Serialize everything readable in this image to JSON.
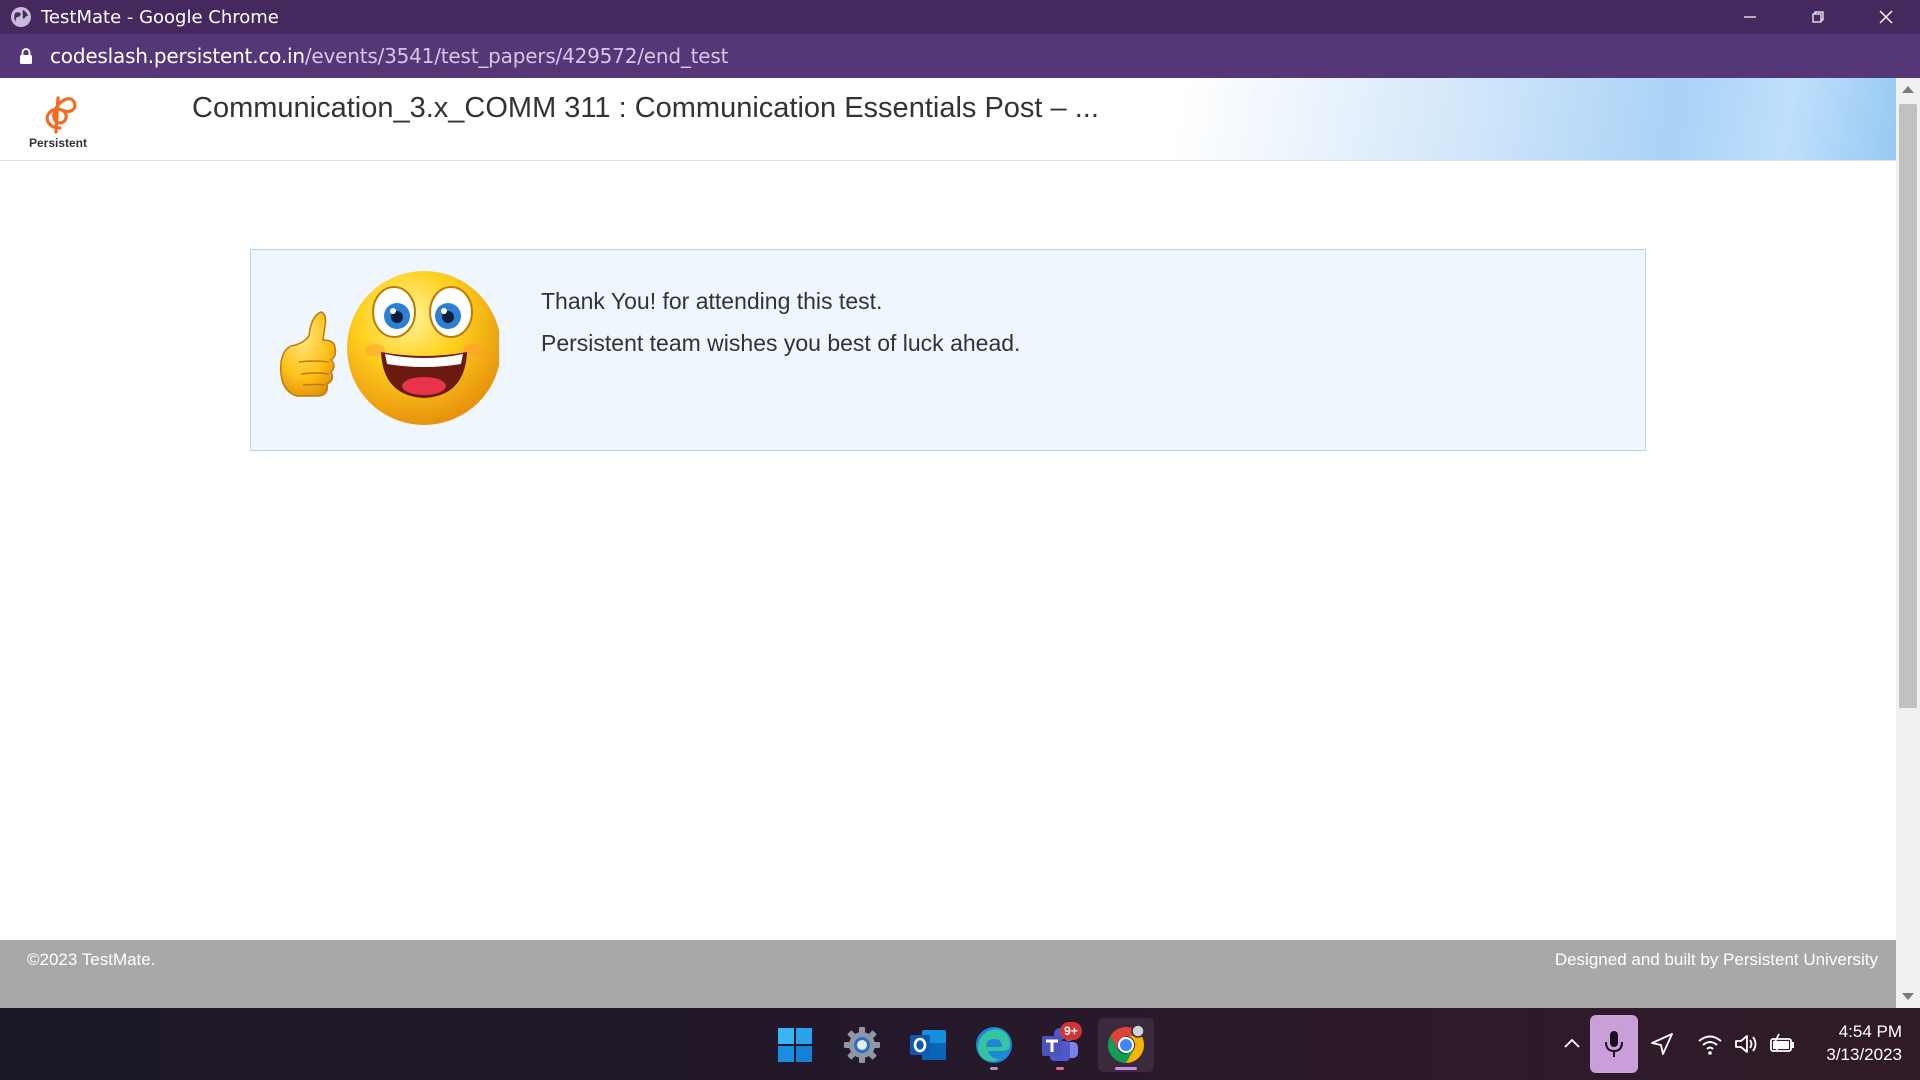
{
  "window": {
    "title": "TestMate - Google Chrome",
    "url_host": "codeslash.persistent.co.in",
    "url_path": "/events/3541/test_papers/429572/end_test"
  },
  "header": {
    "logo_text": "Persistent",
    "test_title": "Communication_3.x_COMM 311 : Communication Essentials Post – ..."
  },
  "message": {
    "line1": "Thank You! for attending this test.",
    "line2": "Persistent team wishes you best of luck ahead."
  },
  "footer": {
    "copyright": "©2023 TestMate.",
    "credit": "Designed and built by Persistent University"
  },
  "taskbar": {
    "apps": [
      "windows-start",
      "settings",
      "outlook",
      "edge",
      "teams",
      "chrome"
    ],
    "teams_badge": "9+",
    "time": "4:54 PM",
    "date": "3/13/2023"
  },
  "colors": {
    "titlebar": "#44285e",
    "addressbar": "#553777",
    "card_bg": "#eff6fd",
    "footer_bg": "#a8a8a8",
    "logo_orange": "#f26b21"
  }
}
